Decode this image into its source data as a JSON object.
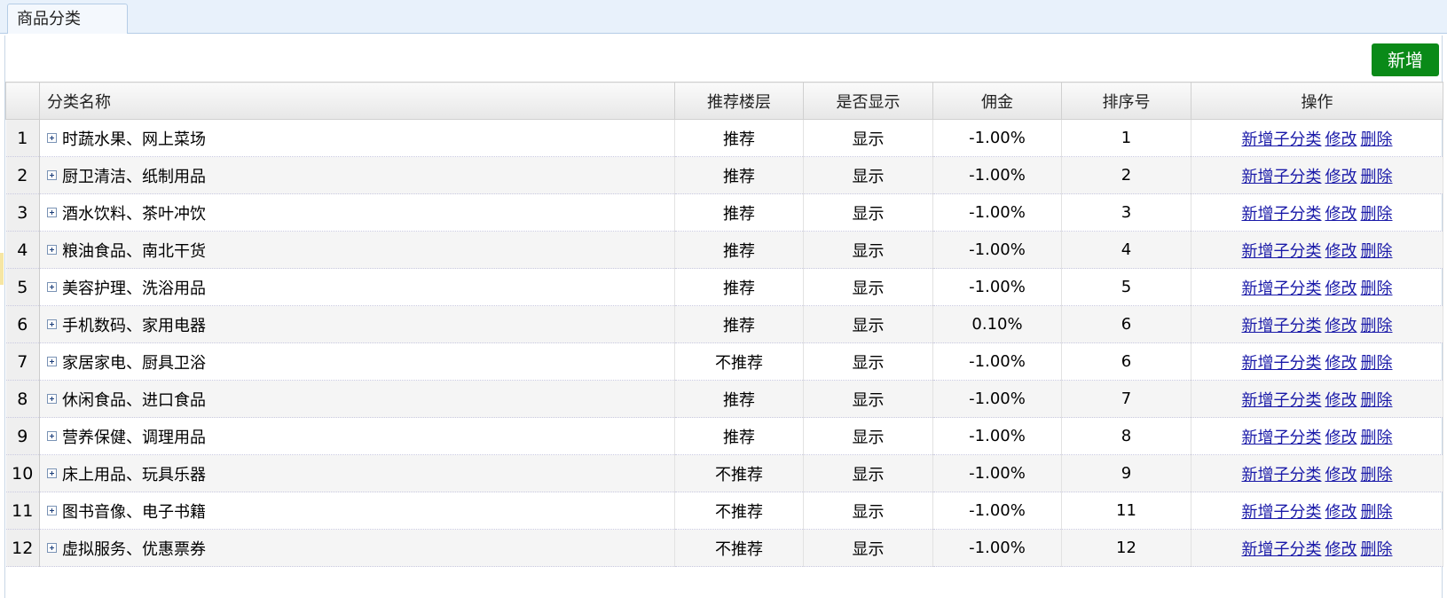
{
  "tab": {
    "label": "商品分类"
  },
  "toolbar": {
    "add_label": "新增"
  },
  "columns": [
    "分类名称",
    "推荐楼层",
    "是否显示",
    "佣金",
    "排序号",
    "操作"
  ],
  "actions": {
    "add_child": "新增子分类",
    "edit": "修改",
    "delete": "删除"
  },
  "rows": [
    {
      "num": "1",
      "name": "时蔬水果、网上菜场",
      "floor": "推荐",
      "show": "显示",
      "commission": "-1.00%",
      "sort": "1"
    },
    {
      "num": "2",
      "name": "厨卫清洁、纸制用品",
      "floor": "推荐",
      "show": "显示",
      "commission": "-1.00%",
      "sort": "2"
    },
    {
      "num": "3",
      "name": "酒水饮料、茶叶冲饮",
      "floor": "推荐",
      "show": "显示",
      "commission": "-1.00%",
      "sort": "3"
    },
    {
      "num": "4",
      "name": "粮油食品、南北干货",
      "floor": "推荐",
      "show": "显示",
      "commission": "-1.00%",
      "sort": "4"
    },
    {
      "num": "5",
      "name": "美容护理、洗浴用品",
      "floor": "推荐",
      "show": "显示",
      "commission": "-1.00%",
      "sort": "5"
    },
    {
      "num": "6",
      "name": "手机数码、家用电器",
      "floor": "推荐",
      "show": "显示",
      "commission": "0.10%",
      "sort": "6"
    },
    {
      "num": "7",
      "name": "家居家电、厨具卫浴",
      "floor": "不推荐",
      "show": "显示",
      "commission": "-1.00%",
      "sort": "6"
    },
    {
      "num": "8",
      "name": "休闲食品、进口食品",
      "floor": "推荐",
      "show": "显示",
      "commission": "-1.00%",
      "sort": "7"
    },
    {
      "num": "9",
      "name": "营养保健、调理用品",
      "floor": "推荐",
      "show": "显示",
      "commission": "-1.00%",
      "sort": "8"
    },
    {
      "num": "10",
      "name": "床上用品、玩具乐器",
      "floor": "不推荐",
      "show": "显示",
      "commission": "-1.00%",
      "sort": "9"
    },
    {
      "num": "11",
      "name": "图书音像、电子书籍",
      "floor": "不推荐",
      "show": "显示",
      "commission": "-1.00%",
      "sort": "11"
    },
    {
      "num": "12",
      "name": "虚拟服务、优惠票券",
      "floor": "不推荐",
      "show": "显示",
      "commission": "-1.00%",
      "sort": "12"
    }
  ]
}
